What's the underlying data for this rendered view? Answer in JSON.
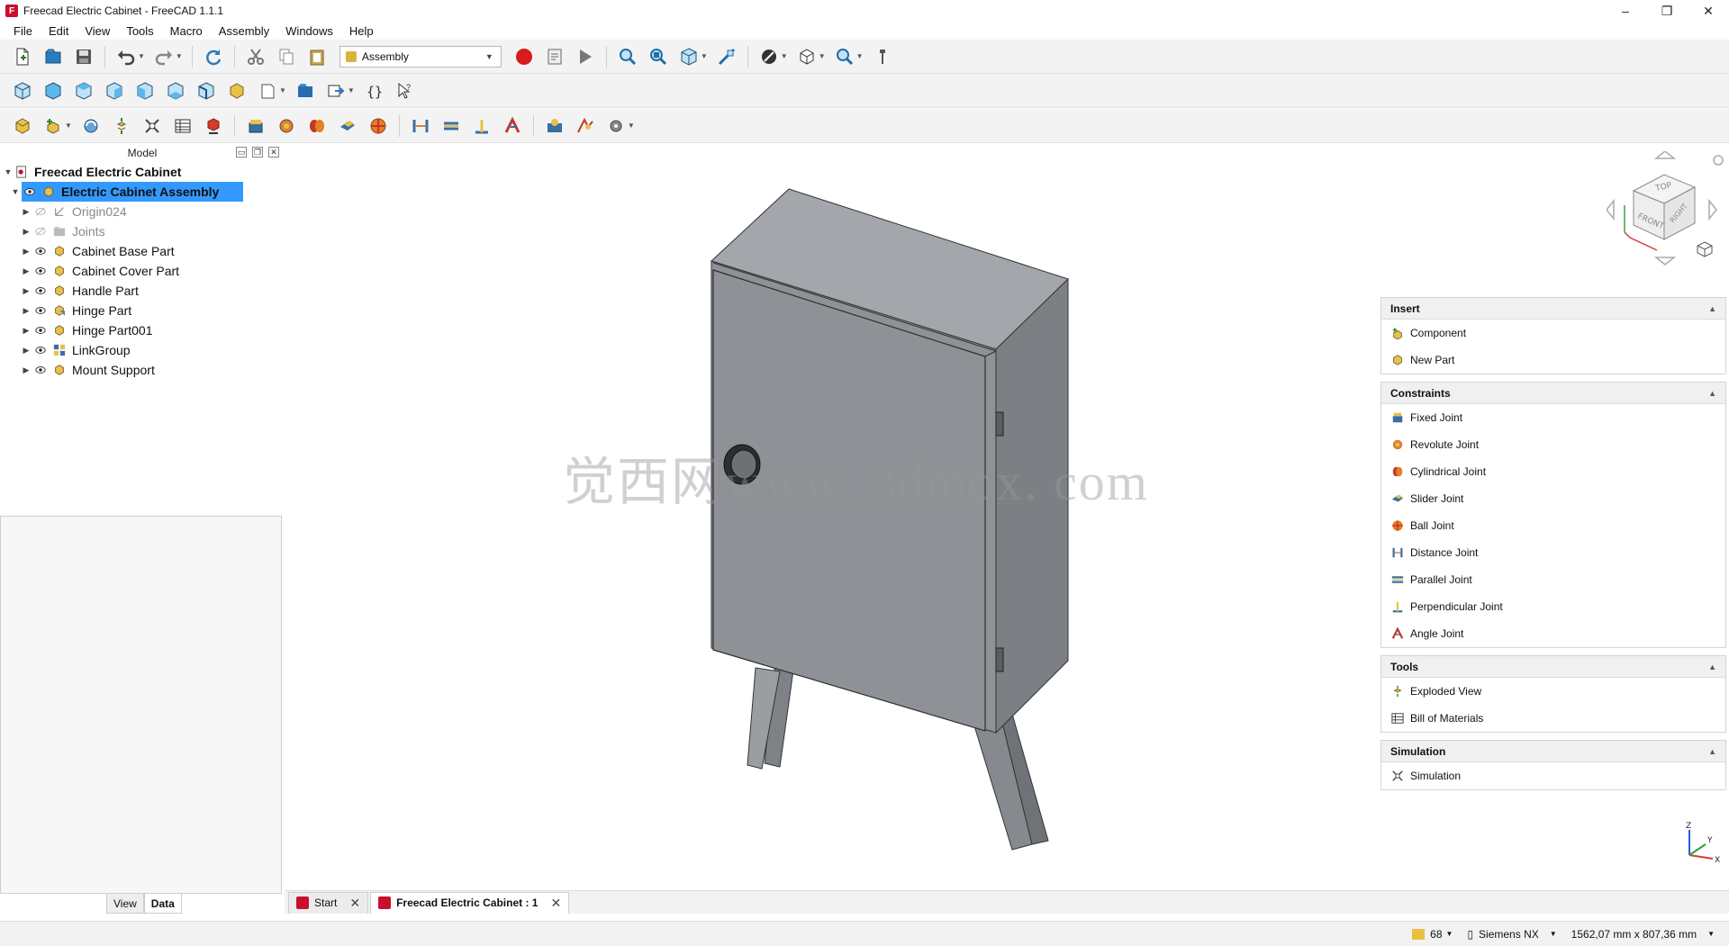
{
  "window": {
    "title": "Freecad Electric Cabinet - FreeCAD 1.1.1",
    "minimize": "–",
    "restore": "❐",
    "close": "✕"
  },
  "menu": [
    "File",
    "Edit",
    "View",
    "Tools",
    "Macro",
    "Assembly",
    "Windows",
    "Help"
  ],
  "toolbar": {
    "workbench": "Assembly"
  },
  "model_panel": {
    "header": "Model",
    "tree": [
      {
        "label": "Freecad Electric Cabinet",
        "level": 0
      },
      {
        "label": "Electric Cabinet Assembly",
        "level": 1
      },
      {
        "label": "Origin024",
        "level": 2
      },
      {
        "label": "Joints",
        "level": 2
      },
      {
        "label": "Cabinet Base Part",
        "level": 2
      },
      {
        "label": "Cabinet Cover Part",
        "level": 2
      },
      {
        "label": "Handle Part",
        "level": 2
      },
      {
        "label": "Hinge Part",
        "level": 2
      },
      {
        "label": "Hinge Part001",
        "level": 2
      },
      {
        "label": "LinkGroup",
        "level": 2
      },
      {
        "label": "Mount Support",
        "level": 2
      }
    ],
    "tabs": [
      "View",
      "Data"
    ]
  },
  "viewport": {
    "watermark": "觉西网www. 3dmox. com",
    "navcube": {
      "top": "TOP",
      "front": "FRONT",
      "right": "RIGHT"
    },
    "axes": {
      "x": "X",
      "y": "Y",
      "z": "Z"
    }
  },
  "task_panel": {
    "insert": {
      "title": "Insert",
      "items": [
        "Component",
        "New Part"
      ]
    },
    "constraints": {
      "title": "Constraints",
      "items": [
        "Fixed Joint",
        "Revolute Joint",
        "Cylindrical Joint",
        "Slider Joint",
        "Ball Joint",
        "Distance Joint",
        "Parallel Joint",
        "Perpendicular Joint",
        "Angle Joint"
      ]
    },
    "tools": {
      "title": "Tools",
      "items": [
        "Exploded View",
        "Bill of Materials"
      ]
    },
    "simulation": {
      "title": "Simulation",
      "items": [
        "Simulation"
      ]
    }
  },
  "doc_tabs": [
    {
      "label": "Start",
      "active": false
    },
    {
      "label": "Freecad Electric Cabinet : 1",
      "active": true
    }
  ],
  "status": {
    "count": "68",
    "nav_style": "Siemens NX",
    "dimensions": "1562,07 mm x 807,36 mm"
  },
  "colors": {
    "selection": "#3399ff",
    "record": "#d81b1b",
    "cabinet_front": "#8e9196",
    "cabinet_top": "#a3a7ac",
    "cabinet_side": "#7c8085"
  }
}
